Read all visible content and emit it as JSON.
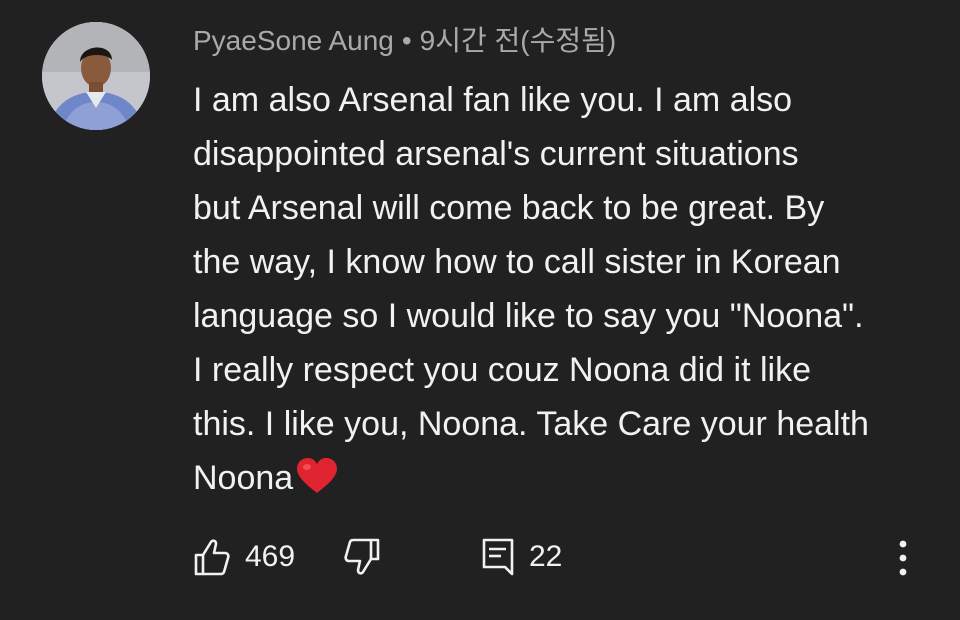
{
  "comment": {
    "author": "PyaeSone Aung",
    "separator": "•",
    "time": "9시간 전(수정됨)",
    "text_lines": [
      "I am also Arsenal fan like you. I am also",
      "disappointed arsenal's current situations",
      "but Arsenal will come back to be great. By",
      "the way, I know how to call sister in Korean",
      "language so I would like to say you \"Noona\".",
      "I really respect you couz Noona did it like",
      "this. I like you, Noona. Take Care your health",
      "Noona"
    ],
    "trailing_emoji": "heart-emoji"
  },
  "actions": {
    "like_count": "469",
    "reply_count": "22",
    "like_icon": "thumbs-up-icon",
    "dislike_icon": "thumbs-down-icon",
    "reply_icon": "comment-reply-icon",
    "more_icon": "more-vertical-icon"
  },
  "colors": {
    "background": "#212121",
    "text_primary": "#f1f1f1",
    "text_secondary": "#aaaaaa",
    "heart": "#e0242f"
  }
}
